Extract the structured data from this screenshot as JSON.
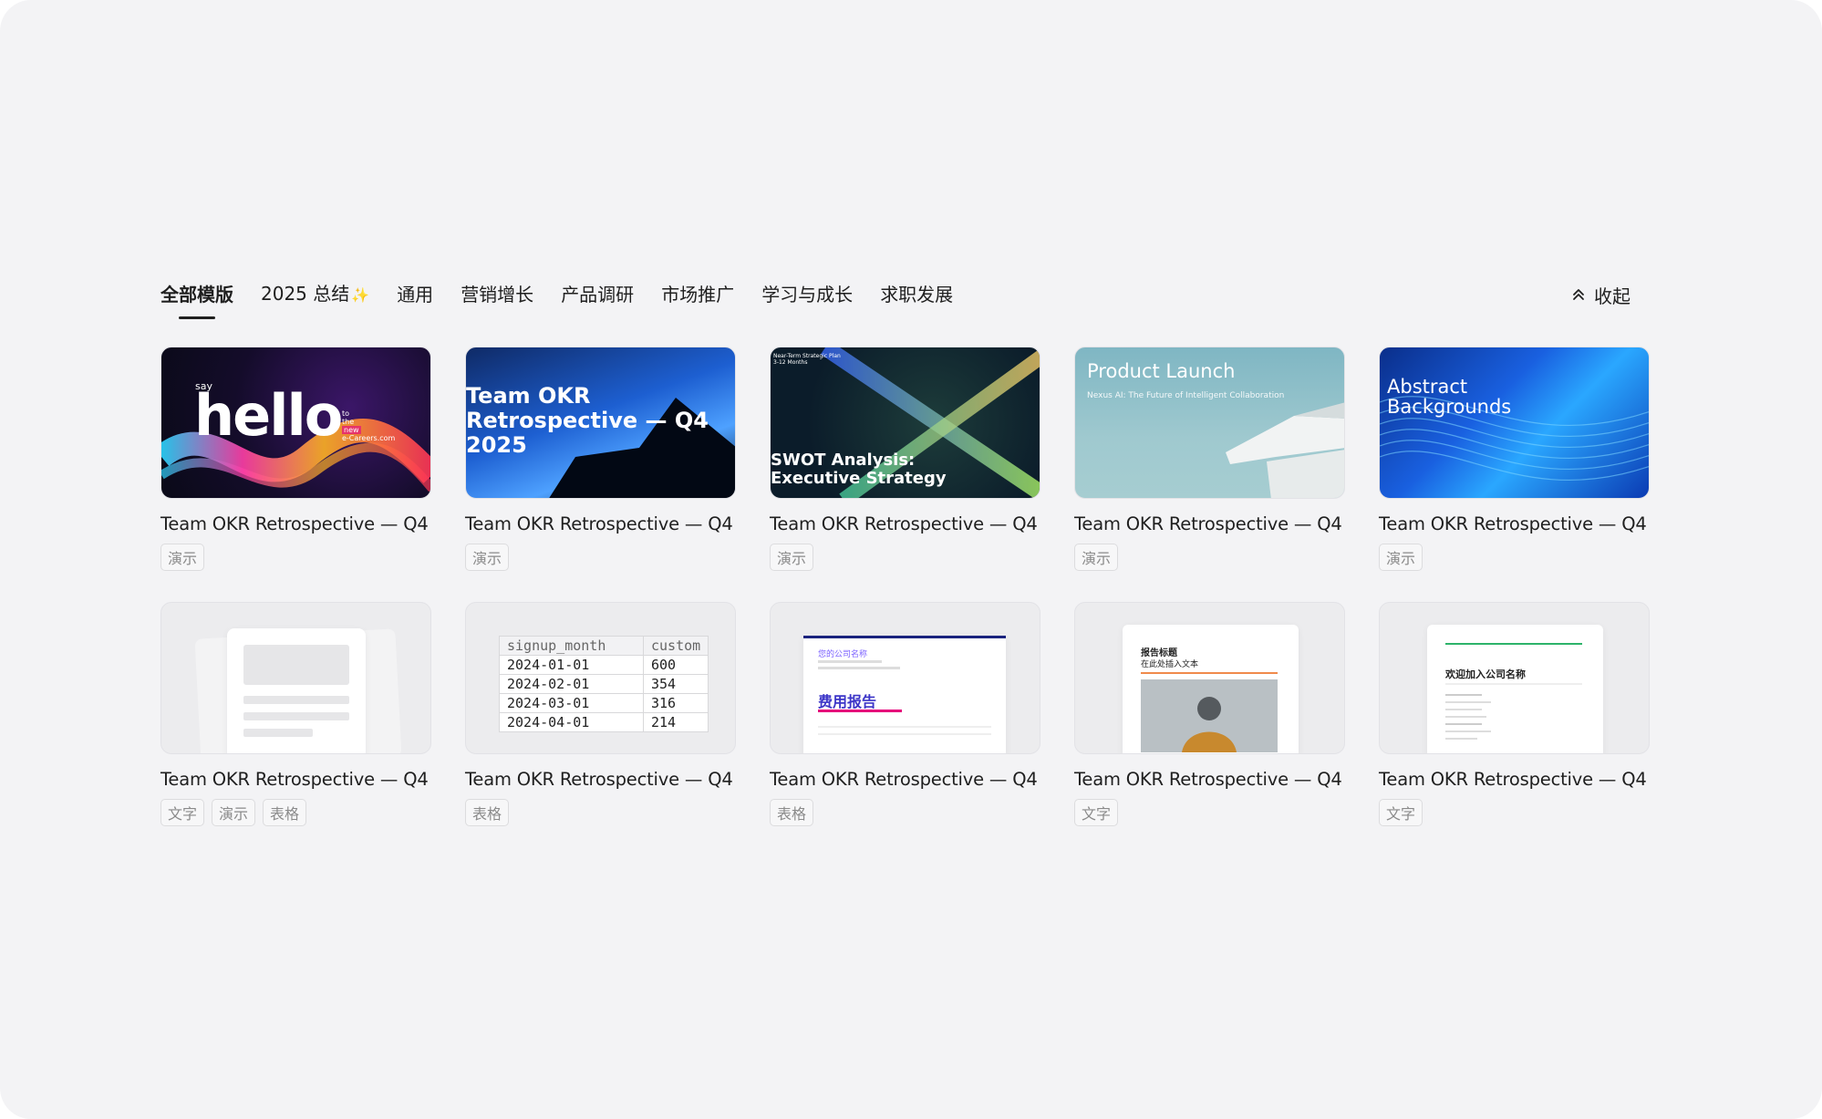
{
  "tabs": [
    {
      "label": "全部模版",
      "active": true
    },
    {
      "label": "2025 总结",
      "icon": "sparkle-icon"
    },
    {
      "label": "通用"
    },
    {
      "label": "营销增长"
    },
    {
      "label": "产品调研"
    },
    {
      "label": "市场推广"
    },
    {
      "label": "学习与成长"
    },
    {
      "label": "求职发展"
    }
  ],
  "collapse_label": "收起",
  "cards": [
    {
      "title": "Team OKR Retrospective — Q4",
      "tags": [
        "演示"
      ],
      "thumb": {
        "kind": "hello",
        "text": "hello",
        "small": "say",
        "side": [
          "to",
          "the",
          "new",
          "e-Careers.com"
        ]
      }
    },
    {
      "title": "Team OKR Retrospective — Q4",
      "tags": [
        "演示"
      ],
      "thumb": {
        "kind": "okr",
        "text": "Team OKR Retrospective — Q4 2025"
      }
    },
    {
      "title": "Team OKR Retrospective — Q4",
      "tags": [
        "演示"
      ],
      "thumb": {
        "kind": "swot",
        "text": "SWOT Analysis: Executive Strategy",
        "small": "Near-Term Strategic Plan 3-12 Months"
      }
    },
    {
      "title": "Team OKR Retrospective — Q4",
      "tags": [
        "演示"
      ],
      "thumb": {
        "kind": "launch",
        "text": "Product Launch",
        "small": "Nexus AI: The Future of Intelligent Collaboration"
      }
    },
    {
      "title": "Team OKR Retrospective — Q4",
      "tags": [
        "演示"
      ],
      "thumb": {
        "kind": "abstract",
        "text": "Abstract Backgrounds"
      }
    },
    {
      "title": "Team OKR Retrospective — Q4",
      "tags": [
        "文字",
        "演示",
        "表格"
      ],
      "thumb": {
        "kind": "blank"
      }
    },
    {
      "title": "Team OKR Retrospective — Q4",
      "tags": [
        "表格"
      ],
      "thumb": {
        "kind": "table",
        "headers": [
          "signup_month",
          "custom"
        ],
        "rows": [
          [
            "2024-01-01",
            "600"
          ],
          [
            "2024-02-01",
            "354"
          ],
          [
            "2024-03-01",
            "316"
          ],
          [
            "2024-04-01",
            "214"
          ]
        ]
      }
    },
    {
      "title": "Team OKR Retrospective — Q4",
      "tags": [
        "表格"
      ],
      "thumb": {
        "kind": "expense",
        "company": "您的公司名称",
        "text": "费用报告"
      }
    },
    {
      "title": "Team OKR Retrospective — Q4",
      "tags": [
        "文字"
      ],
      "thumb": {
        "kind": "report",
        "heading": "报告标题",
        "sub": "在此处插入文本"
      }
    },
    {
      "title": "Team OKR Retrospective — Q4",
      "tags": [
        "文字"
      ],
      "thumb": {
        "kind": "welcome",
        "heading": "欢迎加入公司名称"
      }
    }
  ],
  "colors": {
    "background": "#f3f3f5",
    "text": "#1f1f1f",
    "tag_text": "#8a8a8a"
  }
}
